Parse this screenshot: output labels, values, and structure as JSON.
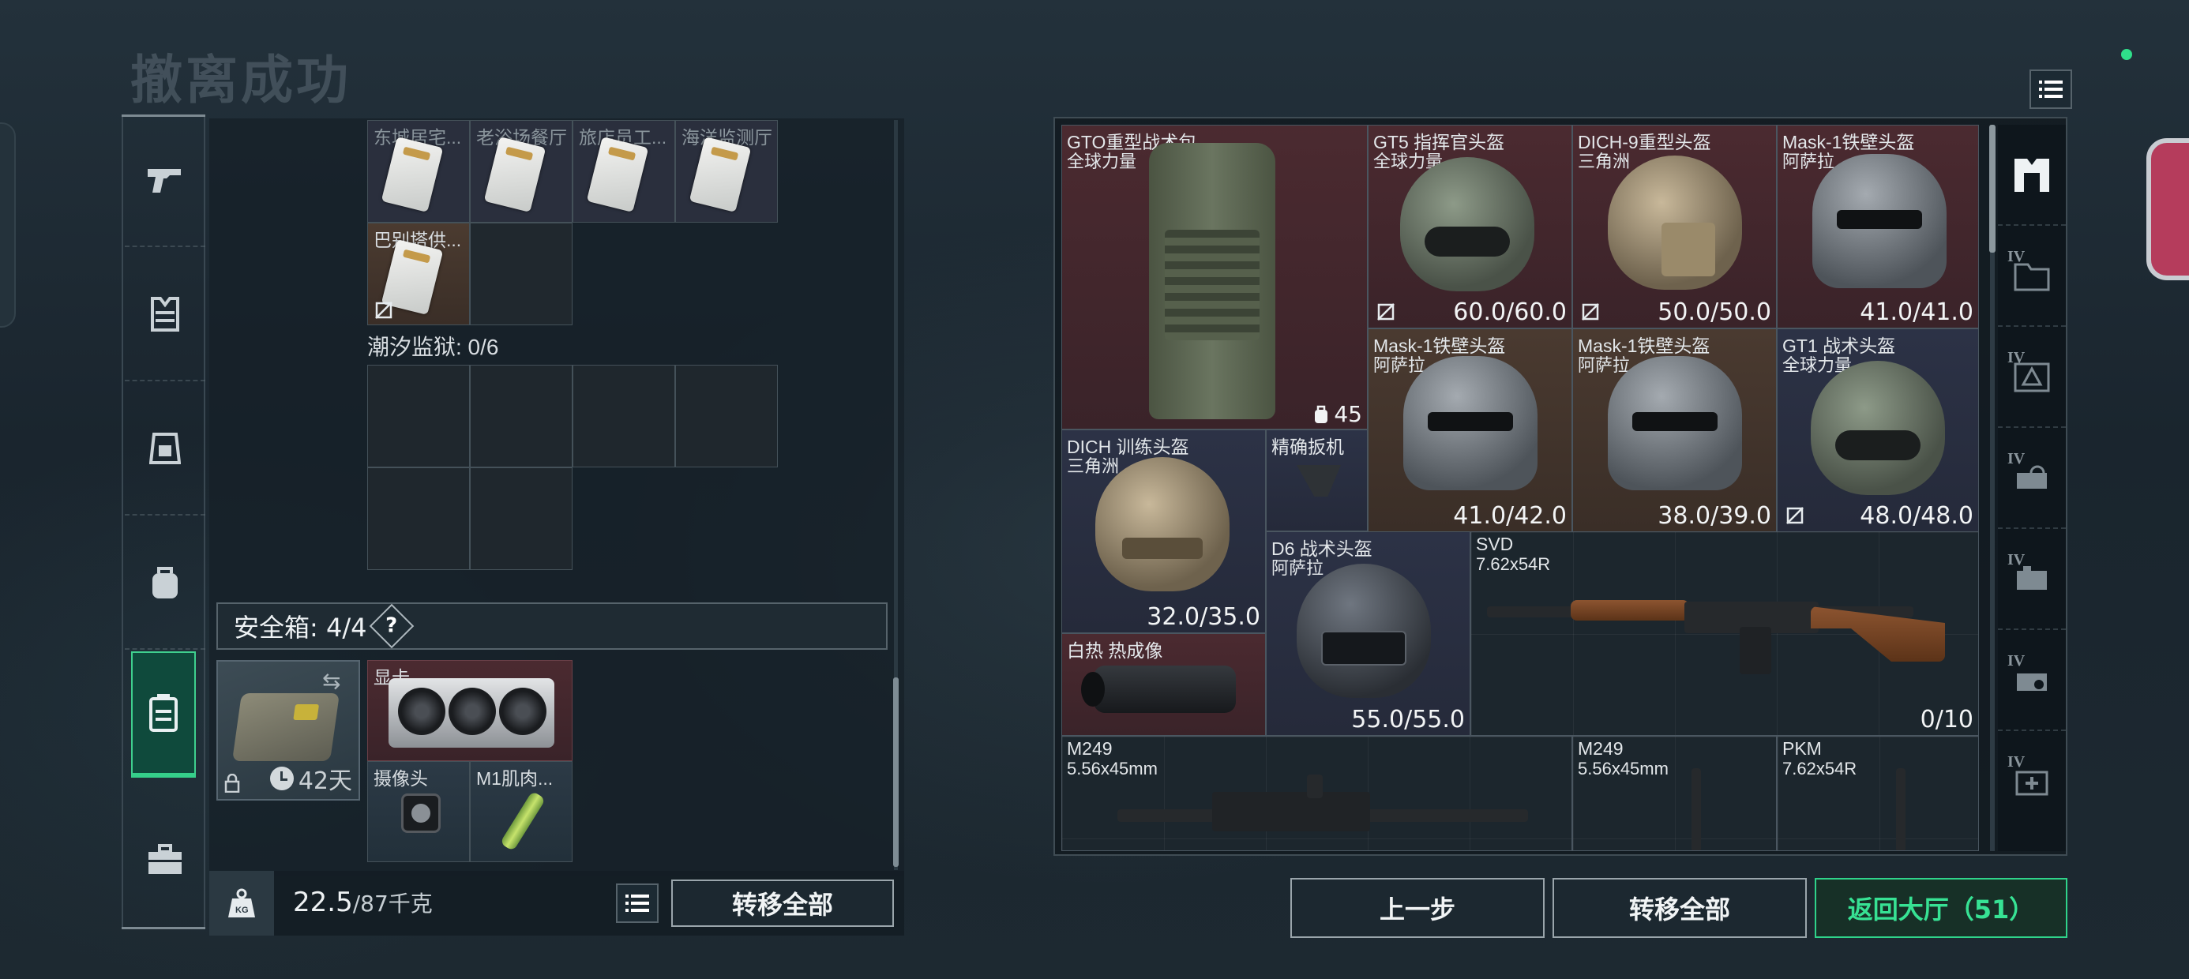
{
  "header": {
    "title": "撤离成功"
  },
  "side_tabs": [
    {
      "name": "weapon",
      "icon": "pistol-icon"
    },
    {
      "name": "armor",
      "icon": "vest-icon"
    },
    {
      "name": "chest-rig",
      "icon": "rig-icon"
    },
    {
      "name": "backpack",
      "icon": "backpack-icon"
    },
    {
      "name": "safebox",
      "icon": "safebox-icon",
      "active": true
    },
    {
      "name": "toolbox",
      "icon": "briefcase-icon"
    }
  ],
  "stash": {
    "top_row": [
      "东城居宅...",
      "老浴场餐厅",
      "旅店员工...",
      "海洋监测厅"
    ],
    "second_row_item": "巴别塔供...",
    "container_label": "潮汐监狱: 0/6"
  },
  "safe_box": {
    "title": "安全箱: 4/4",
    "help": "?",
    "days": "42天",
    "items": [
      {
        "name": "显卡"
      },
      {
        "name": "摄像头"
      },
      {
        "name": "M1肌肉..."
      }
    ]
  },
  "bottom_left": {
    "weight_current": "22.5",
    "weight_max": "/87千克",
    "transfer_all": "转移全部"
  },
  "loot": {
    "items": [
      {
        "id": "gto-backpack",
        "name": "GTO重型战术包",
        "sub": "全球力量",
        "value": "45"
      },
      {
        "id": "gt5-helmet",
        "name": "GT5 指挥官头盔",
        "sub": "全球力量",
        "value": "60.0/60.0"
      },
      {
        "id": "dich9-helmet",
        "name": "DICH-9重型头盔",
        "sub": "三角洲",
        "value": "50.0/50.0"
      },
      {
        "id": "mask1-a",
        "name": "Mask-1铁壁头盔",
        "sub": "阿萨拉",
        "value": "41.0/41.0"
      },
      {
        "id": "mask1-b",
        "name": "Mask-1铁壁头盔",
        "sub": "阿萨拉",
        "value": "41.0/42.0"
      },
      {
        "id": "mask1-c",
        "name": "Mask-1铁壁头盔",
        "sub": "阿萨拉",
        "value": "38.0/39.0"
      },
      {
        "id": "gt1-helmet",
        "name": "GT1 战术头盔",
        "sub": "全球力量",
        "value": "48.0/48.0"
      },
      {
        "id": "dich-training",
        "name": "DICH 训练头盔",
        "sub": "三角洲",
        "value": "32.0/35.0"
      },
      {
        "id": "precise-trigger",
        "name": "精确扳机",
        "sub": "",
        "value": ""
      },
      {
        "id": "d6-helmet",
        "name": "D6 战术头盔",
        "sub": "阿萨拉",
        "value": "55.0/55.0"
      },
      {
        "id": "svd",
        "name": "SVD",
        "sub": "7.62x54R",
        "value": "0/10"
      },
      {
        "id": "thermal",
        "name": "白热 热成像",
        "sub": "",
        "value": ""
      },
      {
        "id": "m249-a",
        "name": "M249",
        "sub": "5.56x45mm",
        "value": ""
      },
      {
        "id": "m249-b",
        "name": "M249",
        "sub": "5.56x45mm",
        "value": ""
      },
      {
        "id": "pkm",
        "name": "PKM",
        "sub": "7.62x54R",
        "value": ""
      }
    ],
    "category_tabs": [
      {
        "tier": "",
        "icon": "armor-vest-icon"
      },
      {
        "tier": "IV",
        "icon": "folder-icon"
      },
      {
        "tier": "IV",
        "icon": "map-icon"
      },
      {
        "tier": "IV",
        "icon": "tool-icon"
      },
      {
        "tier": "IV",
        "icon": "gear-part-icon"
      },
      {
        "tier": "IV",
        "icon": "key-icon"
      },
      {
        "tier": "IV",
        "icon": "medkit-icon"
      }
    ]
  },
  "footer": {
    "prev_step": "上一步",
    "transfer_all": "转移全部",
    "return_lobby": "返回大厅（51）"
  },
  "colors": {
    "accent_green": "#35d08a",
    "red_bg": "#4b2a30",
    "blue_bg": "#2c3246",
    "brown_bg": "#4a3a30"
  }
}
